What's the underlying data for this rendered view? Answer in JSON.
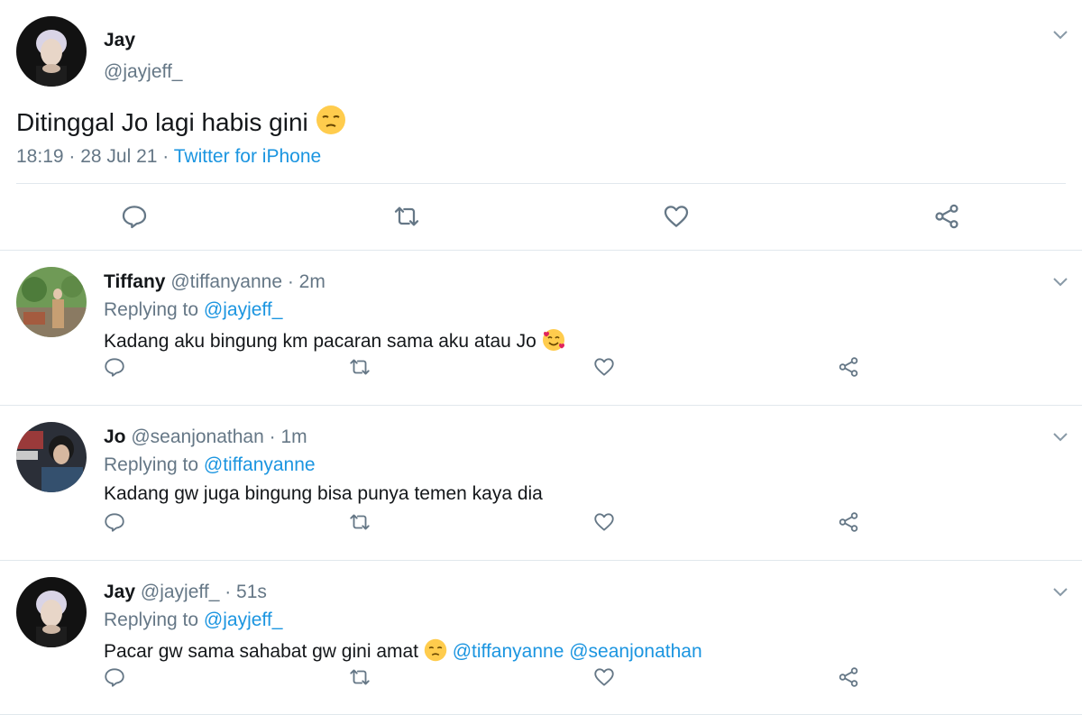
{
  "main_tweet": {
    "name": "Jay",
    "handle": "@jayjeff_",
    "text": "Ditinggal Jo lagi habis gini",
    "emoji": "pensive-face",
    "time": "18:19",
    "sep1": " · ",
    "date": "28 Jul 21",
    "sep2": " · ",
    "source": "Twitter for iPhone"
  },
  "replies": [
    {
      "name": "Tiffany",
      "handle": "@tiffanyanne",
      "age": " · 2m",
      "replying_label": "Replying to ",
      "replying_to": "@jayjeff_",
      "text": "Kadang aku bingung km pacaran sama aku atau Jo",
      "emoji": "smiling-face-with-hearts"
    },
    {
      "name": "Jo",
      "handle": "@seanjonathan",
      "age": " · 1m",
      "replying_label": "Replying to ",
      "replying_to": "@tiffanyanne",
      "text": "Kadang gw juga bingung bisa punya temen kaya dia"
    },
    {
      "name": "Jay",
      "handle": "@jayjeff_",
      "age": " · 51s",
      "replying_label": "Replying to ",
      "replying_to": "@jayjeff_",
      "text": "Pacar gw sama sahabat gw gini amat",
      "emoji": "pensive-face",
      "mention1": "@tiffanyanne",
      "mention2": "@seanjonathan"
    }
  ],
  "colors": {
    "link": "#1b95e0",
    "muted": "#657786",
    "icon": "#657786",
    "divider": "#e1e8ed"
  }
}
